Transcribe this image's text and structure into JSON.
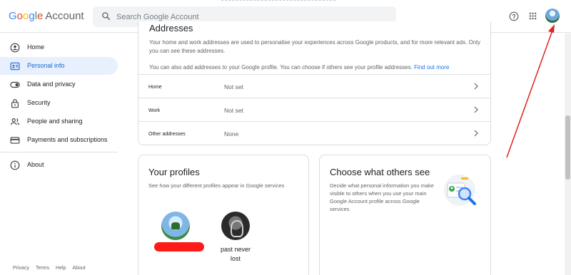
{
  "header": {
    "logo_letters": [
      "G",
      "o",
      "o",
      "g",
      "l",
      "e"
    ],
    "logo_suffix": "Account",
    "search_placeholder": "Search Google Account",
    "icons": [
      "search-icon",
      "help-icon",
      "apps-icon",
      "avatar"
    ]
  },
  "sidebar": {
    "items": [
      {
        "label": "Home",
        "icon": "home-icon"
      },
      {
        "label": "Personal info",
        "icon": "personal-info-icon",
        "active": true
      },
      {
        "label": "Data and privacy",
        "icon": "toggle-icon"
      },
      {
        "label": "Security",
        "icon": "lock-icon"
      },
      {
        "label": "People and sharing",
        "icon": "people-icon"
      },
      {
        "label": "Payments and subscriptions",
        "icon": "card-icon"
      },
      {
        "label": "About",
        "icon": "info-icon"
      }
    ],
    "footer": [
      "Privacy",
      "Terms",
      "Help",
      "About"
    ]
  },
  "addresses": {
    "title": "Addresses",
    "description": "Your home and work addresses are used to personalise your experiences across Google products, and for more relevant ads. Only you can see these addresses.",
    "more_text": "You can also add addresses to your Google profile. You can choose if others see your profile addresses.",
    "more_link": "Find out more",
    "rows": [
      {
        "label": "Home",
        "value": "Not set"
      },
      {
        "label": "Work",
        "value": "Not set"
      },
      {
        "label": "Other addresses",
        "value": "None"
      }
    ]
  },
  "profiles": {
    "title": "Your profiles",
    "description": "See how your different profiles appear in Google services",
    "profile2_name_line1": "past never",
    "profile2_name_line2": "lost"
  },
  "choose": {
    "title": "Choose what others see",
    "description": "Decide what personal information you make visible to others when you use your main Google Account profile across Google services"
  },
  "colors": {
    "accent": "#1a73e8",
    "active_bg": "#e8f0fe",
    "annotation": "#e0211d"
  }
}
